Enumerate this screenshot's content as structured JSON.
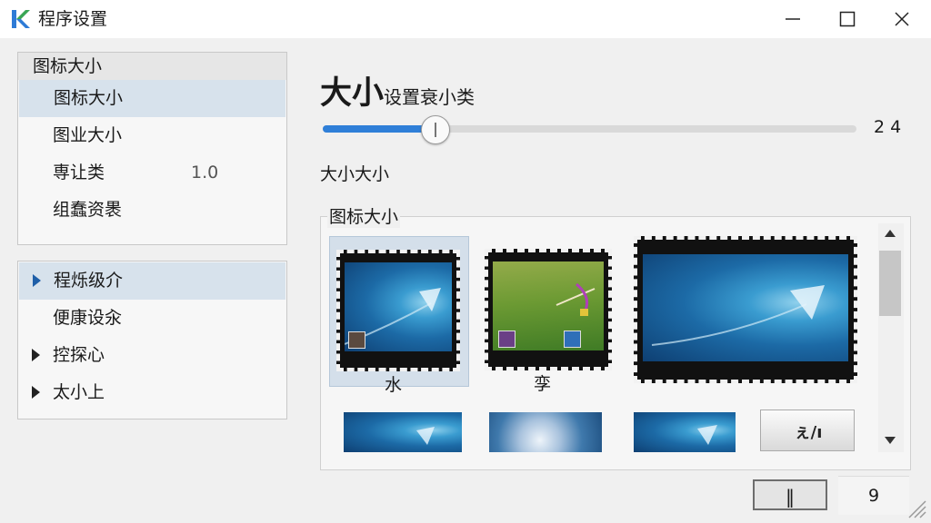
{
  "window": {
    "title": "程序设置",
    "icons": {
      "logo": "app-logo-icon",
      "minimize": "minimize-icon",
      "maximize": "maximize-icon",
      "close": "close-icon"
    },
    "accent_color": "#2f7fd8"
  },
  "sidebar": {
    "header": "图标大小",
    "items": [
      {
        "label": "图标大小",
        "selected": true
      },
      {
        "label": "图业大小"
      },
      {
        "label": "専让类",
        "value": "1.0"
      },
      {
        "label": "组蠢资褁"
      }
    ],
    "tree": [
      {
        "label": "程烁级介",
        "selected": true,
        "expander": "caret-right-icon"
      },
      {
        "label": "便康设汆"
      },
      {
        "label": "控探心",
        "expander": "caret-right-icon"
      },
      {
        "label": "太小上",
        "expander": "caret-right-icon"
      }
    ]
  },
  "main": {
    "heading": "大小",
    "heading_sub": "设置衰小类",
    "slider": {
      "value_label": "2 4",
      "fraction": 0.21
    },
    "section_label": "大小大小",
    "group_title": "图标大小",
    "thumbnails": [
      {
        "caption": "水",
        "kind": "wallpaper",
        "selected": true
      },
      {
        "caption": "孪",
        "kind": "game-scene"
      },
      {
        "caption": "",
        "kind": "wallpaper-large"
      },
      {
        "caption": "",
        "kind": "wallpaper"
      },
      {
        "caption": "",
        "kind": "sphere"
      },
      {
        "caption": "",
        "kind": "wallpaper"
      },
      {
        "caption": "",
        "kind": "logo-tile",
        "tile_text": "ぇ/ı"
      }
    ]
  },
  "footer": {
    "button_label": "‖",
    "field_value": "9"
  }
}
